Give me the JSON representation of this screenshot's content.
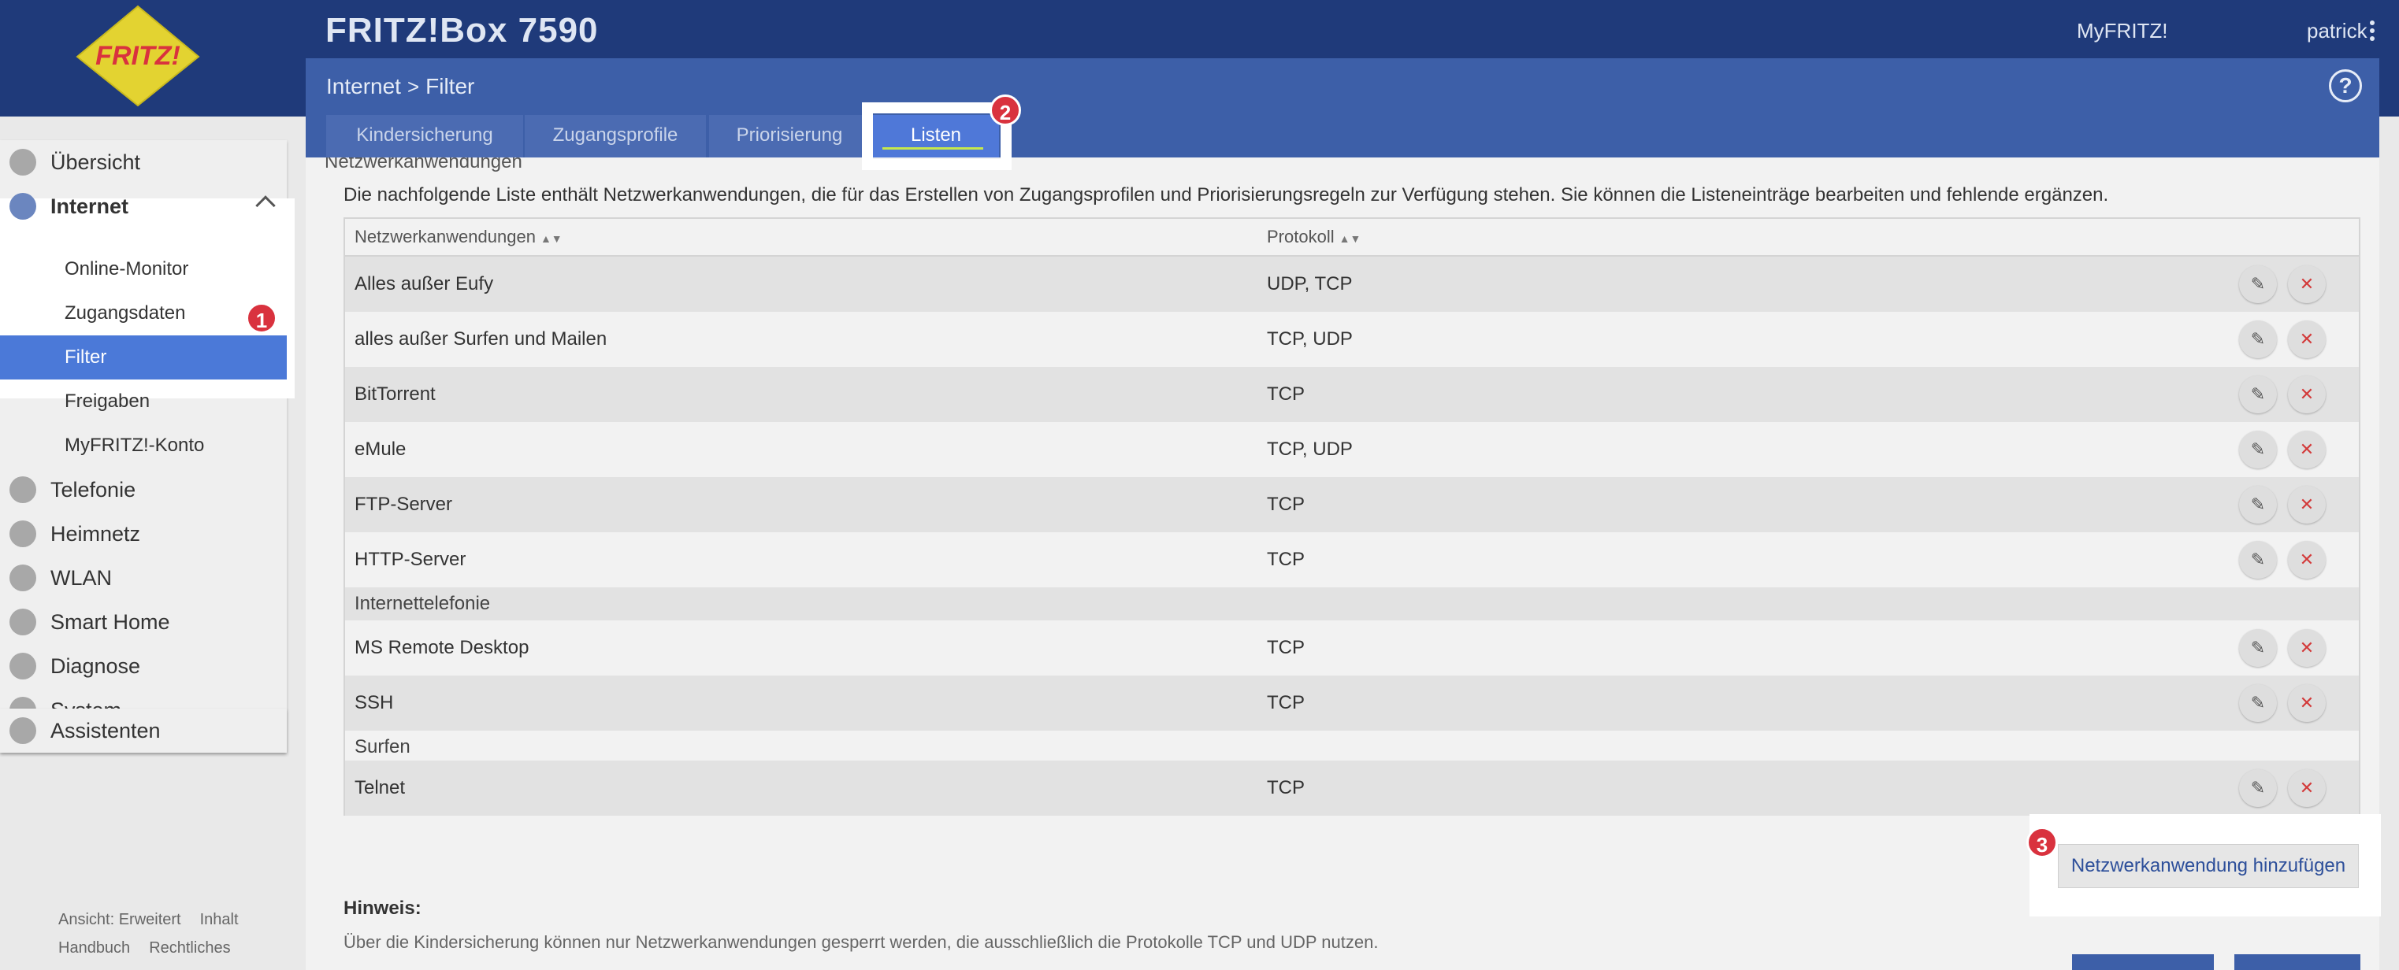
{
  "header": {
    "product_title": "FRITZ!Box 7590",
    "logo_text": "FRITZ!",
    "myfritz_link": "MyFRITZ!",
    "user_name": "patrick"
  },
  "breadcrumb": {
    "parent": "Internet",
    "separator": ">",
    "current": "Filter"
  },
  "tabs": [
    {
      "label": "Kindersicherung",
      "active": false
    },
    {
      "label": "Zugangsprofile",
      "active": false
    },
    {
      "label": "Priorisierung",
      "active": false
    },
    {
      "label": "Listen",
      "active": true
    }
  ],
  "sidebar": {
    "items": [
      {
        "label": "Übersicht",
        "icon": "home-icon"
      },
      {
        "label": "Internet",
        "icon": "globe-icon",
        "expanded": true
      },
      {
        "label": "Telefonie",
        "icon": "phone-icon"
      },
      {
        "label": "Heimnetz",
        "icon": "network-icon"
      },
      {
        "label": "WLAN",
        "icon": "wifi-icon"
      },
      {
        "label": "Smart Home",
        "icon": "smart-home-icon"
      },
      {
        "label": "Diagnose",
        "icon": "diagnose-icon"
      },
      {
        "label": "System",
        "icon": "gear-icon"
      },
      {
        "label": "Assistenten",
        "icon": "wizard-icon"
      }
    ],
    "internet_sub": [
      {
        "label": "Online-Monitor"
      },
      {
        "label": "Zugangsdaten"
      },
      {
        "label": "Filter",
        "active": true
      },
      {
        "label": "Freigaben"
      },
      {
        "label": "MyFRITZ!-Konto"
      }
    ],
    "footer": {
      "view": "Ansicht: Erweitert",
      "content": "Inhalt",
      "manual": "Handbuch",
      "legal": "Rechtliches"
    }
  },
  "markers": {
    "one": "1",
    "two": "2",
    "three": "3"
  },
  "main": {
    "section_title": "Netzwerkanwendungen",
    "intro": "Die nachfolgende Liste enthält Netzwerkanwendungen, die für das Erstellen von Zugangsprofilen und Priorisierungsregeln zur Verfügung stehen. Sie können die Listeneinträge bearbeiten und fehlende ergänzen.",
    "table": {
      "col_name": "Netzwerkanwendungen",
      "col_proto": "Protokoll",
      "rows": [
        {
          "name": "Alles außer Eufy",
          "proto": "UDP, TCP"
        },
        {
          "name": "alles außer Surfen und Mailen",
          "proto": "TCP, UDP"
        },
        {
          "name": "BitTorrent",
          "proto": "TCP"
        },
        {
          "name": "eMule",
          "proto": "TCP, UDP"
        },
        {
          "name": "FTP-Server",
          "proto": "TCP"
        },
        {
          "name": "HTTP-Server",
          "proto": "TCP"
        },
        {
          "group": "Internettelefonie"
        },
        {
          "name": "MS Remote Desktop",
          "proto": "TCP"
        },
        {
          "name": "SSH",
          "proto": "TCP"
        },
        {
          "group": "Surfen"
        },
        {
          "name": "Telnet",
          "proto": "TCP"
        }
      ]
    },
    "add_button": "Netzwerkanwendung hinzufügen",
    "hint_title": "Hinweis:",
    "hint_text": "Über die Kindersicherung können nur Netzwerkanwendungen gesperrt werden, die ausschließlich die Protokolle TCP und UDP nutzen."
  }
}
